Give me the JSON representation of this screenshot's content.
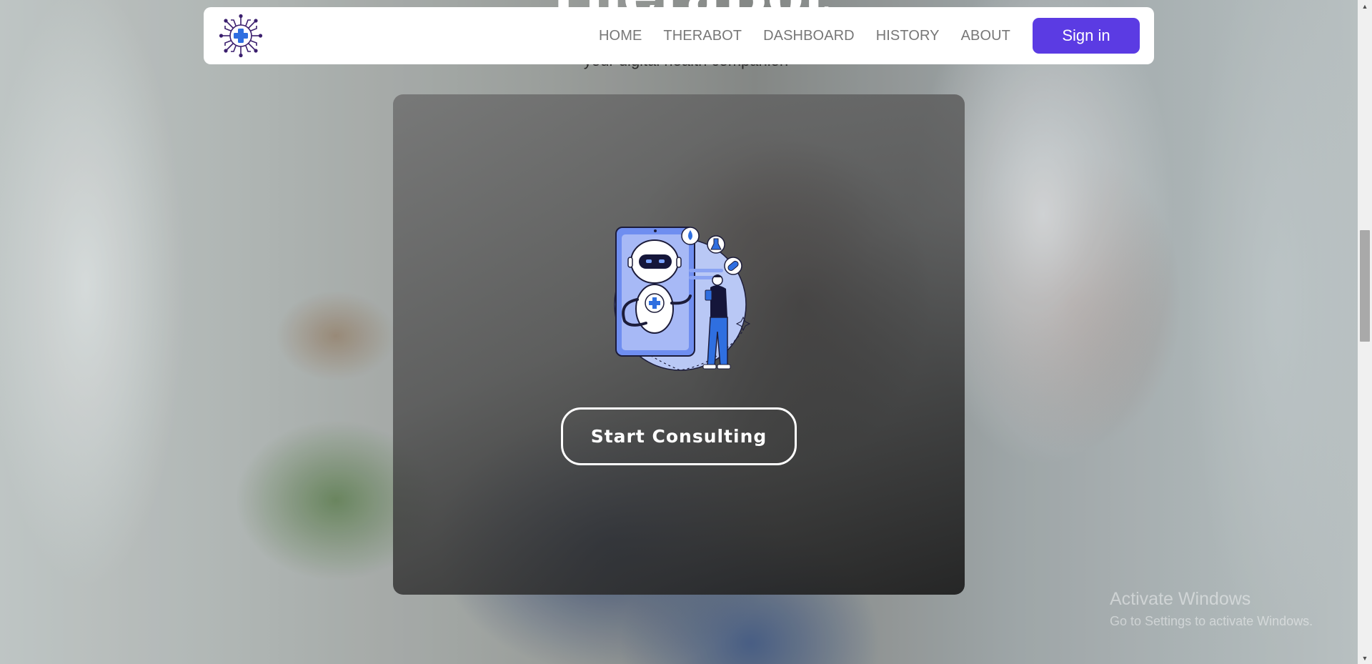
{
  "hero": {
    "title": "TheraBot",
    "subtitle": "your digital health companion"
  },
  "navbar": {
    "logo_icon": "medical-circuit-logo-icon",
    "links": [
      "HOME",
      "THERABOT",
      "DASHBOARD",
      "HISTORY",
      "ABOUT"
    ],
    "signin_label": "Sign in",
    "accent_color": "#5b3be3"
  },
  "card": {
    "illustration_icon": "robot-doctor-illustration",
    "button_label": "Start Consulting"
  },
  "watermark": {
    "title": "Activate Windows",
    "subtitle": "Go to Settings to activate Windows."
  },
  "scrollbar": {
    "position_fraction": 0.35
  }
}
